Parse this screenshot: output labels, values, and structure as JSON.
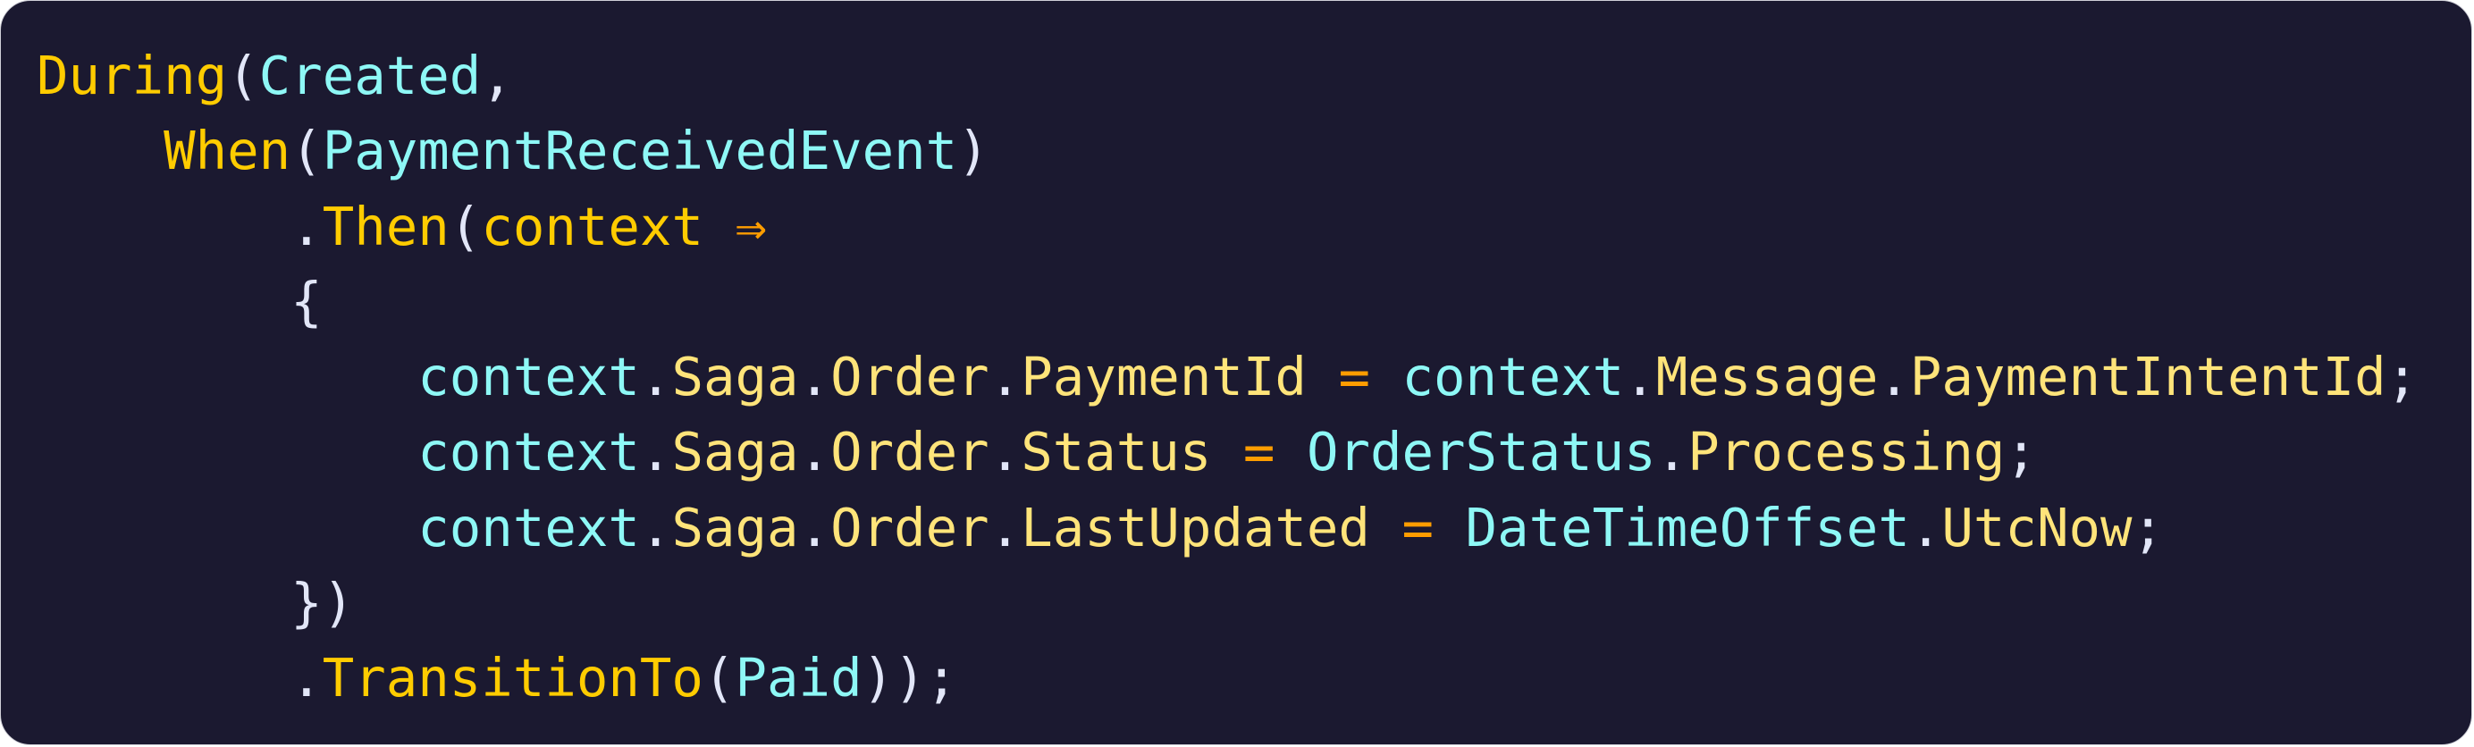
{
  "colors": {
    "background": "#1b1930",
    "keyword": "#ffcc00",
    "identifier": "#8ef8f6",
    "member": "#ffe47a",
    "operator": "#ff9d00",
    "punctuation": "#e2e6f8"
  },
  "code_lines": [
    [
      [
        "kw",
        "During"
      ],
      [
        "pn",
        "("
      ],
      [
        "id",
        "Created"
      ],
      [
        "pn",
        ","
      ]
    ],
    [
      [
        "ws",
        "    "
      ],
      [
        "kw",
        "When"
      ],
      [
        "pn",
        "("
      ],
      [
        "id",
        "PaymentReceivedEvent"
      ],
      [
        "pn",
        ")"
      ]
    ],
    [
      [
        "ws",
        "        "
      ],
      [
        "pn",
        "."
      ],
      [
        "kw",
        "Then"
      ],
      [
        "pn",
        "("
      ],
      [
        "kw",
        "context"
      ],
      [
        "ws",
        " "
      ],
      [
        "op",
        "⇒"
      ]
    ],
    [
      [
        "ws",
        "        "
      ],
      [
        "pn",
        "{"
      ]
    ],
    [
      [
        "ws",
        "            "
      ],
      [
        "id",
        "context"
      ],
      [
        "pn",
        "."
      ],
      [
        "mem",
        "Saga"
      ],
      [
        "pn",
        "."
      ],
      [
        "mem",
        "Order"
      ],
      [
        "pn",
        "."
      ],
      [
        "mem",
        "PaymentId"
      ],
      [
        "ws",
        " "
      ],
      [
        "op",
        "="
      ],
      [
        "ws",
        " "
      ],
      [
        "id",
        "context"
      ],
      [
        "pn",
        "."
      ],
      [
        "mem",
        "Message"
      ],
      [
        "pn",
        "."
      ],
      [
        "mem",
        "PaymentIntentId"
      ],
      [
        "pn",
        ";"
      ]
    ],
    [
      [
        "ws",
        "            "
      ],
      [
        "id",
        "context"
      ],
      [
        "pn",
        "."
      ],
      [
        "mem",
        "Saga"
      ],
      [
        "pn",
        "."
      ],
      [
        "mem",
        "Order"
      ],
      [
        "pn",
        "."
      ],
      [
        "mem",
        "Status"
      ],
      [
        "ws",
        " "
      ],
      [
        "op",
        "="
      ],
      [
        "ws",
        " "
      ],
      [
        "id",
        "OrderStatus"
      ],
      [
        "pn",
        "."
      ],
      [
        "mem",
        "Processing"
      ],
      [
        "pn",
        ";"
      ]
    ],
    [
      [
        "ws",
        "            "
      ],
      [
        "id",
        "context"
      ],
      [
        "pn",
        "."
      ],
      [
        "mem",
        "Saga"
      ],
      [
        "pn",
        "."
      ],
      [
        "mem",
        "Order"
      ],
      [
        "pn",
        "."
      ],
      [
        "mem",
        "LastUpdated"
      ],
      [
        "ws",
        " "
      ],
      [
        "op",
        "="
      ],
      [
        "ws",
        " "
      ],
      [
        "id",
        "DateTimeOffset"
      ],
      [
        "pn",
        "."
      ],
      [
        "mem",
        "UtcNow"
      ],
      [
        "pn",
        ";"
      ]
    ],
    [
      [
        "ws",
        "        "
      ],
      [
        "pn",
        "})"
      ]
    ],
    [
      [
        "ws",
        "        "
      ],
      [
        "pn",
        "."
      ],
      [
        "kw",
        "TransitionTo"
      ],
      [
        "pn",
        "("
      ],
      [
        "id",
        "Paid"
      ],
      [
        "pn",
        "));"
      ]
    ]
  ]
}
